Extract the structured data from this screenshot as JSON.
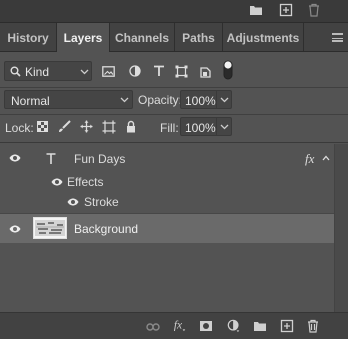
{
  "tabs": [
    {
      "label": "History"
    },
    {
      "label": "Layers"
    },
    {
      "label": "Channels"
    },
    {
      "label": "Paths"
    },
    {
      "label": "Adjustments"
    }
  ],
  "active_tab": "Layers",
  "filter": {
    "kind_label": "Kind"
  },
  "blend": {
    "mode": "Normal",
    "opacity_label": "Opacity:",
    "opacity_value": "100%"
  },
  "lock": {
    "label": "Lock:",
    "fill_label": "Fill:",
    "fill_value": "100%"
  },
  "layers": [
    {
      "name": "Fun Days",
      "type": "text",
      "fx_label": "fx",
      "effects_label": "Effects",
      "stroke_label": "Stroke",
      "visible": true
    },
    {
      "name": "Background",
      "type": "image",
      "visible": true,
      "selected": true
    }
  ],
  "icons": {
    "top": [
      "folder-icon",
      "new-layer-icon",
      "trash-icon"
    ],
    "filter": [
      "image-filter-icon",
      "adjustment-filter-icon",
      "type-filter-icon",
      "shape-filter-icon",
      "smart-object-filter-icon",
      "filter-toggle-icon"
    ],
    "lock": [
      "lock-transparent-icon",
      "lock-pixels-icon",
      "lock-position-icon",
      "lock-artboard-icon",
      "lock-all-icon"
    ],
    "bottom": [
      "link-layers-icon",
      "fx-icon",
      "add-mask-icon",
      "adjustment-layer-icon",
      "group-folder-icon",
      "new-layer-icon",
      "trash-icon"
    ]
  },
  "colors": {
    "panel": "#535353",
    "selected_row": "#6a6a6a",
    "tab_bar": "#424242"
  }
}
